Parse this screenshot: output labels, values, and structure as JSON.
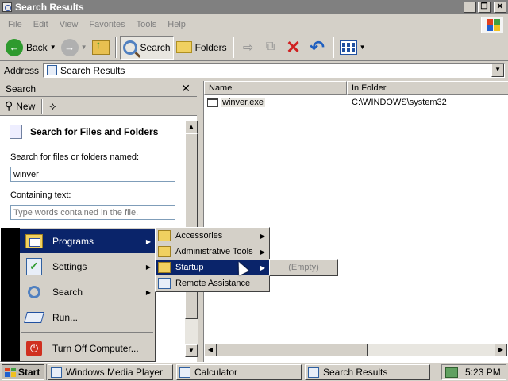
{
  "window": {
    "title": "Search Results",
    "controls": {
      "minimize": "_",
      "maximize": "❐",
      "close": "✕"
    }
  },
  "menubar": {
    "items": [
      "File",
      "Edit",
      "View",
      "Favorites",
      "Tools",
      "Help"
    ]
  },
  "toolbar": {
    "back_label": "Back",
    "search_label": "Search",
    "folders_label": "Folders"
  },
  "address": {
    "label": "Address",
    "value": "Search Results"
  },
  "search_pane": {
    "header": "Search",
    "new_label": "New",
    "heading": "Search for Files and Folders",
    "named_label": "Search for files or folders named:",
    "named_value": "winver",
    "containing_label": "Containing text:",
    "containing_placeholder": "Type words contained in the file."
  },
  "results": {
    "columns": [
      "Name",
      "In Folder"
    ],
    "rows": [
      {
        "name": "winver.exe",
        "folder": "C:\\WINDOWS\\system32"
      }
    ]
  },
  "start_menu": {
    "items": [
      "Programs",
      "Settings",
      "Search",
      "Run...",
      "Turn Off Computer..."
    ]
  },
  "programs_submenu": {
    "items": [
      "Accessories",
      "Administrative Tools",
      "Startup",
      "Remote Assistance"
    ]
  },
  "startup_submenu": {
    "empty_label": "(Empty)"
  },
  "taskbar": {
    "start_label": "Start",
    "buttons": [
      "Windows Media Player",
      "Calculator",
      "Search Results"
    ],
    "clock": "5:23 PM"
  },
  "icons": {
    "back": "green-arrow-left",
    "forward": "gray-arrow-right",
    "up": "folder-up",
    "search": "magnifier",
    "folders": "folder",
    "delete": "red-x",
    "undo": "blue-undo-arrow",
    "views": "views-grid"
  },
  "colors": {
    "highlight": "#0a246a",
    "face": "#d4d0c8",
    "title_inactive": "#808080"
  }
}
